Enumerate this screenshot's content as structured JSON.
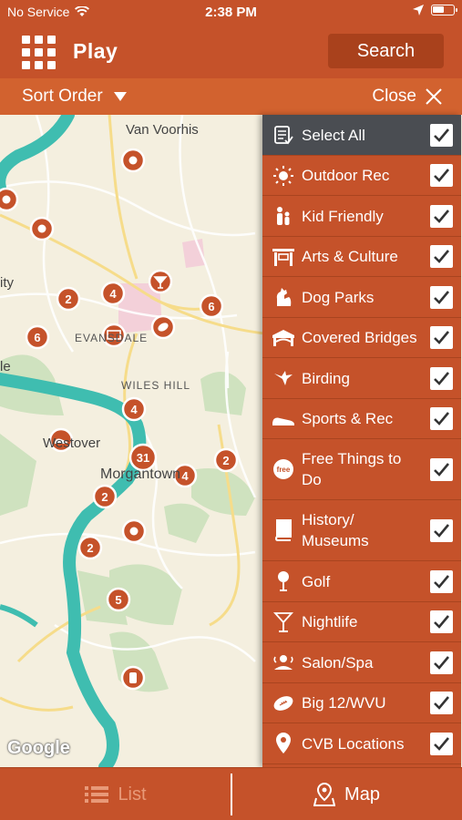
{
  "status": {
    "carrier": "No Service",
    "time": "2:38 PM",
    "wifi_icon": "wifi-icon",
    "location_icon": "location-arrow-icon",
    "battery_icon": "battery-icon"
  },
  "header": {
    "title": "Play",
    "menu_icon": "grid-menu-icon",
    "search_label": "Search"
  },
  "sort_bar": {
    "sort_label": "Sort Order",
    "close_label": "Close"
  },
  "map": {
    "labels": [
      "Van Voorhis",
      "ity",
      "EVANSDALE",
      "WILES HILL",
      "le",
      "Westover",
      "Morgantown"
    ],
    "attribution": "Google",
    "markers": [
      {
        "kind": "cluster",
        "value": "2"
      },
      {
        "kind": "cluster",
        "value": "4"
      },
      {
        "kind": "cluster",
        "value": "6"
      },
      {
        "kind": "cluster",
        "value": "6"
      },
      {
        "kind": "cluster",
        "value": "4"
      },
      {
        "kind": "cluster",
        "value": "31"
      },
      {
        "kind": "cluster",
        "value": "4"
      },
      {
        "kind": "cluster",
        "value": "2"
      },
      {
        "kind": "cluster",
        "value": "2"
      },
      {
        "kind": "cluster",
        "value": "2"
      },
      {
        "kind": "cluster",
        "value": "5"
      }
    ]
  },
  "filters": [
    {
      "label": "Select All",
      "icon": "checklist-icon",
      "checked": true
    },
    {
      "label": "Outdoor Rec",
      "icon": "sun-icon",
      "checked": true
    },
    {
      "label": "Kid Friendly",
      "icon": "family-icon",
      "checked": true
    },
    {
      "label": "Arts & Culture",
      "icon": "theater-icon",
      "checked": true
    },
    {
      "label": "Dog Parks",
      "icon": "dog-icon",
      "checked": true
    },
    {
      "label": "Covered Bridges",
      "icon": "bridge-icon",
      "checked": true
    },
    {
      "label": "Birding",
      "icon": "bird-icon",
      "checked": true
    },
    {
      "label": "Sports & Rec",
      "icon": "sneaker-icon",
      "checked": true
    },
    {
      "label": "Free Things to Do",
      "icon": "free-badge-icon",
      "checked": true
    },
    {
      "label": "History/ Museums",
      "icon": "book-icon",
      "checked": true
    },
    {
      "label": "Golf",
      "icon": "golf-icon",
      "checked": true
    },
    {
      "label": "Nightlife",
      "icon": "cocktail-icon",
      "checked": true
    },
    {
      "label": "Salon/Spa",
      "icon": "spa-icon",
      "checked": true
    },
    {
      "label": "Big 12/WVU",
      "icon": "football-icon",
      "checked": true
    },
    {
      "label": "CVB Locations",
      "icon": "map-pin-icon",
      "checked": true
    }
  ],
  "tabs": {
    "list_label": "List",
    "map_label": "Map"
  },
  "colors": {
    "brand_orange": "#c5522a",
    "sort_bar": "#d2622f",
    "select_all_bg": "#4a4d52",
    "river": "#3fbdb0"
  }
}
